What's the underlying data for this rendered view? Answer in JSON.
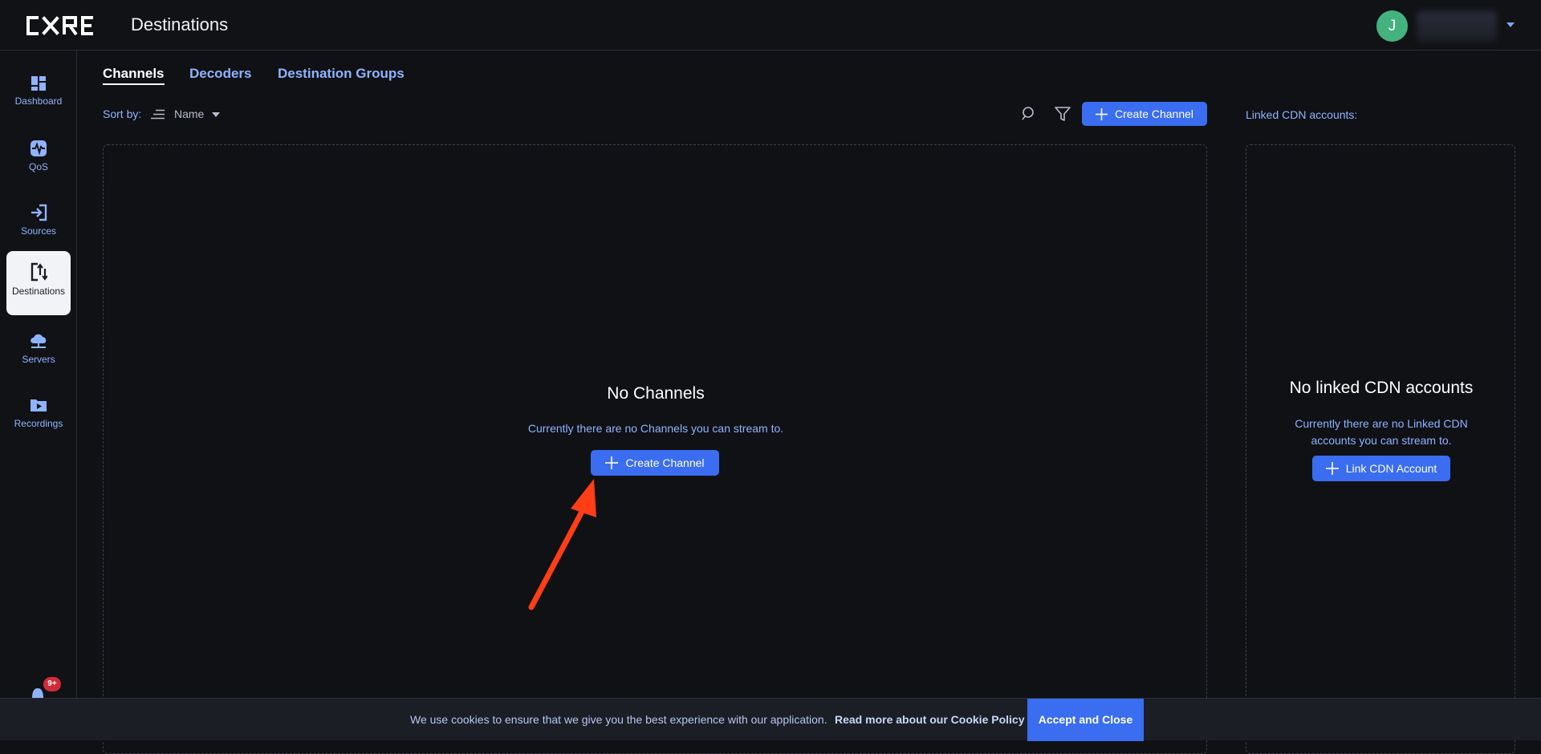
{
  "app": {
    "logo_text": "CORE",
    "page_title": "Destinations",
    "user_initial": "J"
  },
  "sidebar": {
    "items": [
      {
        "label": "Dashboard",
        "icon": "dashboard-icon"
      },
      {
        "label": "QoS",
        "icon": "qos-icon"
      },
      {
        "label": "Sources",
        "icon": "sources-icon"
      },
      {
        "label": "Destinations",
        "icon": "destinations-icon",
        "active": true
      },
      {
        "label": "Servers",
        "icon": "servers-icon"
      },
      {
        "label": "Recordings",
        "icon": "recordings-icon"
      }
    ],
    "notifications_badge": "9+"
  },
  "tabs": [
    {
      "label": "Channels",
      "active": true
    },
    {
      "label": "Decoders"
    },
    {
      "label": "Destination Groups"
    }
  ],
  "toolbar": {
    "sort_label": "Sort by:",
    "sort_value": "Name",
    "create_channel_label": "Create Channel"
  },
  "channels_panel": {
    "empty_title": "No Channels",
    "empty_text": "Currently there are no Channels you can stream to.",
    "create_channel_label": "Create Channel"
  },
  "cdn_panel": {
    "header_label": "Linked CDN accounts:",
    "empty_title": "No linked CDN accounts",
    "empty_text_line1": "Currently there are no Linked CDN",
    "empty_text_line2": "accounts you can stream to.",
    "link_button_label": "Link CDN Account"
  },
  "cookie_bar": {
    "text": "We use cookies to ensure that we give you the best experience with our application.",
    "link_text": "Read more about our Cookie Policy",
    "accept_label": "Accept and Close"
  },
  "colors": {
    "background": "#101115",
    "accent": "#3a6df0",
    "link": "#8fb3ff",
    "avatar": "#43b27f",
    "badge": "#d12b3a",
    "annotation_arrow": "#ff3d17"
  }
}
